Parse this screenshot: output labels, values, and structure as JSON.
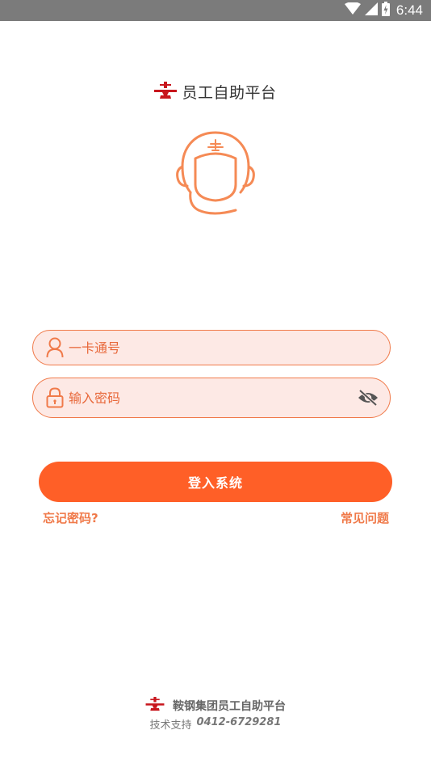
{
  "status_bar": {
    "time": "6:44",
    "icons": [
      "wifi-icon",
      "cell-signal-icon",
      "battery-icon"
    ]
  },
  "header": {
    "logo_icon": "airplane-logo-icon",
    "title": "员工自助平台",
    "mascot_icon": "headset-avatar-icon"
  },
  "form": {
    "card_placeholder": "一卡通号",
    "card_value": "",
    "password_placeholder": "输入密码",
    "password_value": "",
    "password_visibility": "hidden"
  },
  "actions": {
    "login_label": "登入系统",
    "forgot_label": "忘记密码?",
    "faq_label": "常见问题"
  },
  "footer": {
    "company": "鞍钢集团员工自助平台",
    "support_label": "技术支持",
    "support_phone": "0412-6729281"
  },
  "colors": {
    "accent": "#ff5f27",
    "accent_light": "#f07a4a",
    "field_bg": "#fde9e5",
    "logo_red": "#c8161d",
    "status_bar": "#7b7b7b"
  }
}
